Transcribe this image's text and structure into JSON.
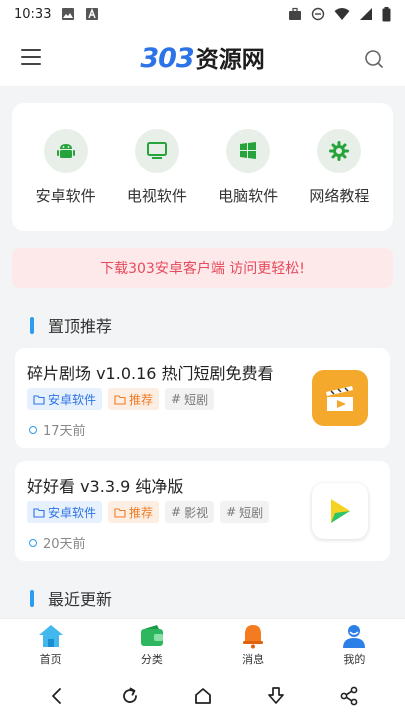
{
  "status": {
    "time": "10:33"
  },
  "header": {
    "brand_number": "303",
    "brand_text": "资源网"
  },
  "categories": [
    {
      "label": "安卓软件",
      "icon": "android-icon"
    },
    {
      "label": "电视软件",
      "icon": "tv-icon"
    },
    {
      "label": "电脑软件",
      "icon": "windows-icon"
    },
    {
      "label": "网络教程",
      "icon": "gear-icon"
    }
  ],
  "notice": "下载303安卓客户端 访问更轻松!",
  "section_pinned": "置顶推荐",
  "section_latest": "最近更新",
  "posts": [
    {
      "title": "碎片剧场 v1.0.16 热门短剧免费看",
      "tags": [
        {
          "text": "安卓软件",
          "kind": "category"
        },
        {
          "text": "推荐",
          "kind": "feature"
        },
        {
          "text": "短剧",
          "kind": "hashtag"
        }
      ],
      "time": "17天前",
      "thumb_icon": "clapper-play-icon"
    },
    {
      "title": "好好看 v3.3.9 纯净版",
      "tags": [
        {
          "text": "安卓软件",
          "kind": "category"
        },
        {
          "text": "推荐",
          "kind": "feature"
        },
        {
          "text": "影视",
          "kind": "hashtag"
        },
        {
          "text": "短剧",
          "kind": "hashtag"
        }
      ],
      "time": "20天前",
      "thumb_icon": "play-logo-icon"
    }
  ],
  "tabs": [
    {
      "label": "首页",
      "icon": "home-icon",
      "active": true
    },
    {
      "label": "分类",
      "icon": "wallet-icon"
    },
    {
      "label": "消息",
      "icon": "bell-icon"
    },
    {
      "label": "我的",
      "icon": "user-icon"
    }
  ],
  "colors": {
    "accent": "#2d73e8",
    "notice_bg": "#fde8ea",
    "notice_text": "#e64a5c",
    "tag_blue": "#2d73e8",
    "tag_orange": "#f07b24"
  }
}
